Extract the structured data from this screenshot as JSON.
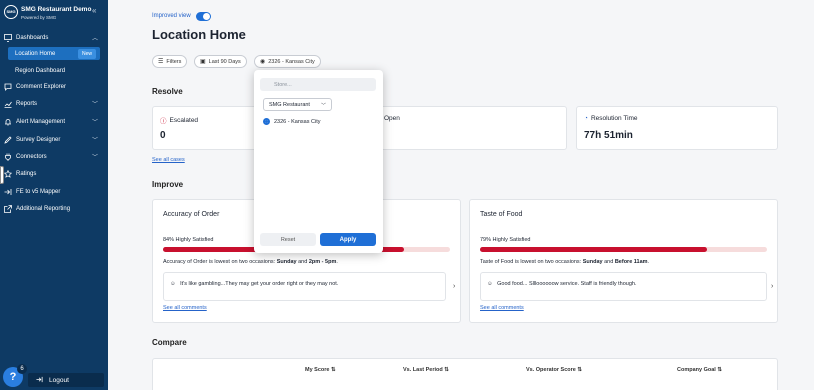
{
  "sidebar": {
    "brand_title": "SMG Restaurant Demo",
    "brand_sub": "Powered by SMG",
    "brand_logo_text": "SMG",
    "collapse_icon": "«",
    "dashboards": "Dashboards",
    "location_home": "Location Home",
    "new_badge": "New",
    "region_dashboard": "Region Dashboard",
    "comment_explorer": "Comment Explorer",
    "reports": "Reports",
    "alert_management": "Alert Management",
    "survey_designer": "Survey Designer",
    "connectors": "Connectors",
    "ratings": "Ratings",
    "fe_mapper": "FE to v5 Mapper",
    "additional_reporting": "Additional Reporting",
    "logout": "Logout",
    "help_glyph": "?",
    "help_count": "6"
  },
  "header": {
    "improved_view": "Improved view",
    "title": "Location Home"
  },
  "filters": {
    "filters_label": "Filters",
    "period_label": "Last 90 Days",
    "store_label": "2326 - Kansas City"
  },
  "resolve": {
    "heading": "Resolve",
    "escalated_label": "Escalated",
    "escalated_value": "0",
    "open_label": "Open",
    "resolution_label": "Resolution Time",
    "resolution_value": "77h 51min",
    "see_all_cases": "See all cases"
  },
  "improve": {
    "heading": "Improve",
    "cards": [
      {
        "title": "Accuracy of Order",
        "pct_label": "84% Highly Satisfied",
        "pct": 84,
        "desc_pre": "Accuracy of Order is lowest on two occasions: ",
        "desc_b1": "Sunday",
        "desc_mid": " and ",
        "desc_b2": "2pm - 5pm",
        "desc_end": ".",
        "comment": "It's like gambling...They may get your order right or they may not.",
        "see_all": "See all comments"
      },
      {
        "title": "Taste of Food",
        "pct_label": "79% Highly Satisfied",
        "pct": 79,
        "desc_pre": "Taste of Food is lowest on two occasions: ",
        "desc_b1": "Sunday",
        "desc_mid": " and ",
        "desc_b2": "Before 11am",
        "desc_end": ".",
        "comment": "Good food... Sllloooooow service. Staff is friendly though.",
        "see_all": "See all comments"
      }
    ]
  },
  "compare": {
    "heading": "Compare",
    "columns": [
      "My Score ⇅",
      "Vs. Last Period ⇅",
      "Vs. Operator Score ⇅",
      "Company Goal ⇅"
    ]
  },
  "store_popup": {
    "search_placeholder": "Store...",
    "select_value": "SMG Restaurant",
    "option_label": "2326 - Kansas City",
    "reset_label": "Reset",
    "apply_label": "Apply"
  },
  "colors": {
    "sidebar_bg": "#0e3a64",
    "accent": "#1f6fd6",
    "bar_fill": "#c8102e",
    "bar_track": "#f6dcdc"
  }
}
